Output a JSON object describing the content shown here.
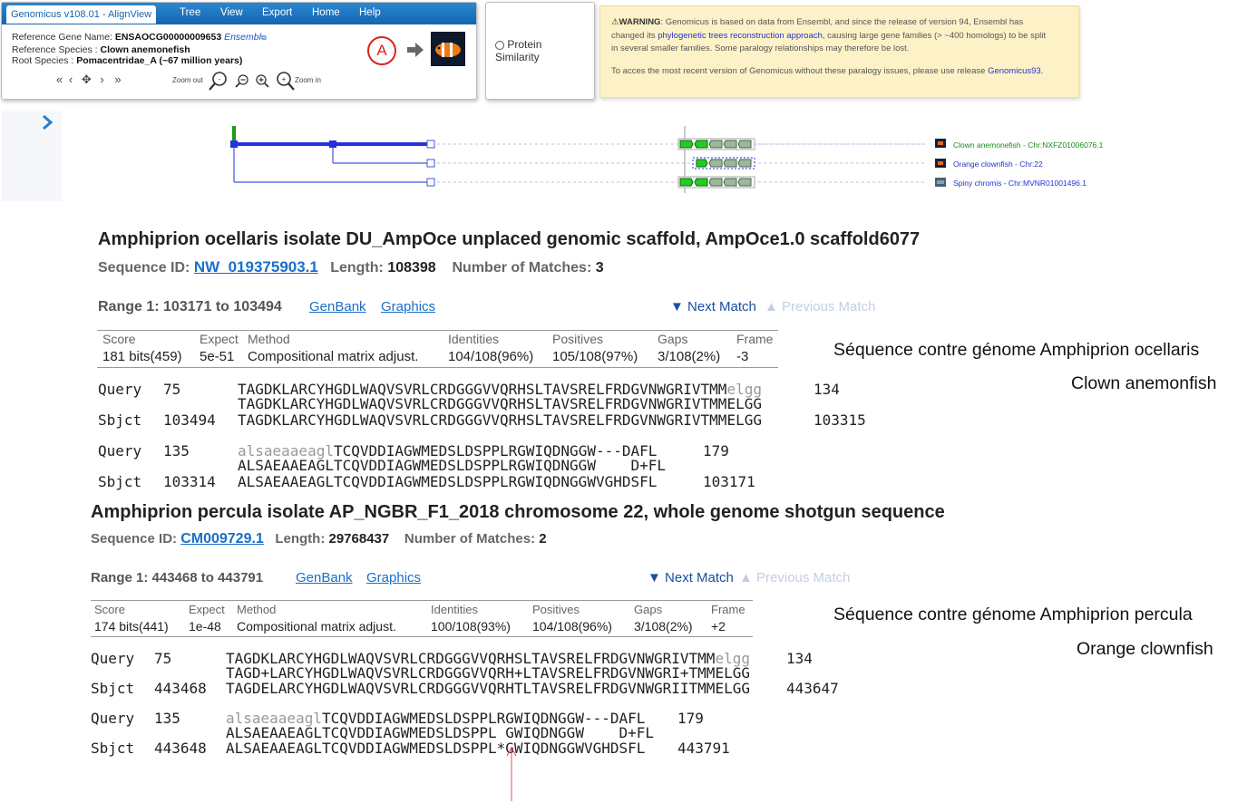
{
  "genomicus": {
    "title": "Genomicus v108.01 - AlignView",
    "menu": [
      "Tree",
      "View",
      "Export",
      "Home",
      "Help"
    ],
    "ref_gene_label": "Reference Gene Name:",
    "ref_gene_value": "ENSAOCG00000009653",
    "ensembl_link": "Ensembl",
    "ref_species_label": "Reference Species :",
    "ref_species_value": "Clown anemonefish",
    "root_species_label": "Root Species :",
    "root_species_value": "Pomacentridae_A (~67 million years)",
    "zoom_out": "Zoom out",
    "zoom_in": "Zoom in",
    "circle_letter": "A",
    "nav_icons": [
      "double-left-arrow-icon",
      "left-arrow-icon",
      "move-icon",
      "right-arrow-icon",
      "double-right-arrow-icon"
    ]
  },
  "protein": {
    "label_line1": "Protein",
    "label_line2": "Similarity"
  },
  "warning": {
    "title": "WARNING",
    "text1": ": Genomicus is based on data from Ensembl, and since the release of version 94, Ensembl has",
    "text2a": "changed its ",
    "link1": "phylogenetic trees reconstruction approach",
    "text2b": ", causing large gene families (> ~400 homologs) to be split",
    "text3": "in several smaller families. Some paralogy relationships may therefore be lost.",
    "text4": "To acces the most recent version of Genomicus without these paralogy issues, please use release ",
    "link2": "Genomicus93",
    "text4_end": "."
  },
  "tree": {
    "species": [
      {
        "label": "Clown anemonefish - Chr:NXFZ01006076.1",
        "color": "#1a8a1a"
      },
      {
        "label": "Orange clownfish - Chr:22",
        "color": "#2233cc"
      },
      {
        "label": "Spiny chromis - Chr:MVNR01001496.1",
        "color": "#2233cc"
      }
    ]
  },
  "hit1": {
    "title": "Amphiprion ocellaris isolate DU_AmpOce unplaced genomic scaffold, AmpOce1.0 scaffold6077",
    "seqid_label": "Sequence ID:",
    "seqid": "NW_019375903.1",
    "length_label": "Length:",
    "length": "108398",
    "matches_label": "Number of Matches:",
    "matches": "3",
    "range": "Range 1: 103171 to 103494",
    "genbank": "GenBank",
    "graphics": "Graphics",
    "next": "▼ Next Match",
    "prev": "▲ Previous Match",
    "headers": [
      "Score",
      "Expect",
      "Method",
      "Identities",
      "Positives",
      "Gaps",
      "Frame"
    ],
    "values": [
      "181 bits(459)",
      "5e-51",
      "Compositional matrix adjust.",
      "104/108(96%)",
      "105/108(97%)",
      "3/108(2%)",
      "-3"
    ],
    "align": [
      {
        "label": "Query",
        "start": "75",
        "upper": "TAGDKLARCYHGDLWAQVSVRLCRDGGGVVQRHSLTAVSRELFRDGVNWGRIVTMM",
        "lower": "elgg",
        "end": "134"
      },
      {
        "mid": "TAGDKLARCYHGDLWAQVSVRLCRDGGGVVQRHSLTAVSRELFRDGVNWGRIVTMMELGG"
      },
      {
        "label": "Sbjct",
        "start": "103494",
        "seq": "TAGDKLARCYHGDLWAQVSVRLCRDGGGVVQRHSLTAVSRELFRDGVNWGRIVTMMELGG",
        "end": "103315"
      },
      {
        "label": "Query",
        "start": "135",
        "lower": "alsaeaaeagl",
        "upper": "TCQVDDIAGWMEDSLDSPPLRGWIQDNGGW---DAFL",
        "end": "179"
      },
      {
        "mid": "ALSAEAAEAGLTCQVDDIAGWMEDSLDSPPLRGWIQDNGGW    D+FL"
      },
      {
        "label": "Sbjct",
        "start": "103314",
        "seq": "ALSAEAAEAGLTCQVDDIAGWMEDSLDSPPLRGWIQDNGGWVGHDSFL",
        "end": "103171"
      }
    ],
    "note1": "Séquence contre génome Amphiprion ocellaris",
    "note2": "Clown anemonfish"
  },
  "hit2": {
    "title": "Amphiprion percula isolate AP_NGBR_F1_2018 chromosome 22, whole genome shotgun sequence",
    "seqid_label": "Sequence ID:",
    "seqid": "CM009729.1",
    "length_label": "Length:",
    "length": "29768437",
    "matches_label": "Number of Matches:",
    "matches": "2",
    "range": "Range 1: 443468 to 443791",
    "genbank": "GenBank",
    "graphics": "Graphics",
    "next": "▼ Next Match",
    "prev": "▲ Previous Match",
    "headers": [
      "Score",
      "Expect",
      "Method",
      "Identities",
      "Positives",
      "Gaps",
      "Frame"
    ],
    "values": [
      "174 bits(441)",
      "1e-48",
      "Compositional matrix adjust.",
      "100/108(93%)",
      "104/108(96%)",
      "3/108(2%)",
      "+2"
    ],
    "align": [
      {
        "label": "Query",
        "start": "75",
        "upper": "TAGDKLARCYHGDLWAQVSVRLCRDGGGVVQRHSLTAVSRELFRDGVNWGRIVTMM",
        "lower": "elgg",
        "end": "134"
      },
      {
        "mid": "TAGD+LARCYHGDLWAQVSVRLCRDGGGVVQRH+LTAVSRELFRDGVNWGRI+TMMELGG"
      },
      {
        "label": "Sbjct",
        "start": "443468",
        "seq": "TAGDELARCYHGDLWAQVSVRLCRDGGGVVQRHTLTAVSRELFRDGVNWGRIITMMELGG",
        "end": "443647"
      },
      {
        "label": "Query",
        "start": "135",
        "lower": "alsaeaaeagl",
        "upper": "TCQVDDIAGWMEDSLDSPPLRGWIQDNGGW---DAFL",
        "end": "179"
      },
      {
        "mid": "ALSAEAAEAGLTCQVDDIAGWMEDSLDSPPL GWIQDNGGW    D+FL"
      },
      {
        "label": "Sbjct",
        "start": "443648",
        "seq": "ALSAEAAEAGLTCQVDDIAGWMEDSLDSPPL*GWIQDNGGWVGHDSFL",
        "end": "443791"
      }
    ],
    "note1": "Séquence contre génome Amphiprion percula",
    "note2": "Orange clownfish"
  }
}
